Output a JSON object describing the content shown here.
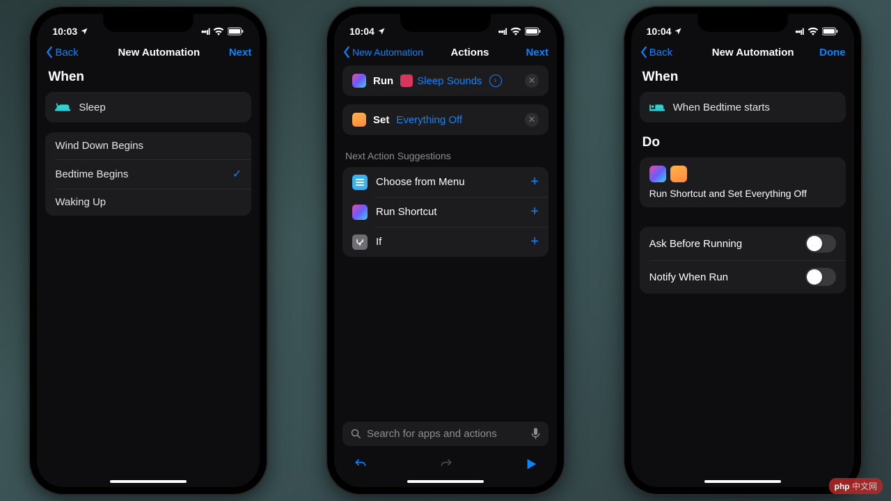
{
  "phone1": {
    "status_time": "10:03",
    "nav_back": "Back",
    "nav_title": "New Automation",
    "nav_next": "Next",
    "section_when": "When",
    "trigger_label": "Sleep",
    "options": [
      {
        "label": "Wind Down Begins",
        "selected": false
      },
      {
        "label": "Bedtime Begins",
        "selected": true
      },
      {
        "label": "Waking Up",
        "selected": false
      }
    ]
  },
  "phone2": {
    "status_time": "10:04",
    "nav_back": "New Automation",
    "nav_title": "Actions",
    "nav_next": "Next",
    "action_run": {
      "verb": "Run",
      "param": "Sleep Sounds"
    },
    "action_set": {
      "verb": "Set",
      "param": "Everything Off"
    },
    "suggest_header": "Next Action Suggestions",
    "suggestions": [
      {
        "label": "Choose from Menu",
        "icon": "menu"
      },
      {
        "label": "Run Shortcut",
        "icon": "shortcuts"
      },
      {
        "label": "If",
        "icon": "if"
      }
    ],
    "search_placeholder": "Search for apps and actions"
  },
  "phone3": {
    "status_time": "10:04",
    "nav_back": "Back",
    "nav_title": "New Automation",
    "nav_done": "Done",
    "section_when": "When",
    "trigger_label": "When Bedtime starts",
    "section_do": "Do",
    "do_summary": "Run Shortcut and Set Everything Off",
    "settings": [
      {
        "label": "Ask Before Running",
        "on": false
      },
      {
        "label": "Notify When Run",
        "on": false
      }
    ]
  },
  "watermark": "php 中文网"
}
